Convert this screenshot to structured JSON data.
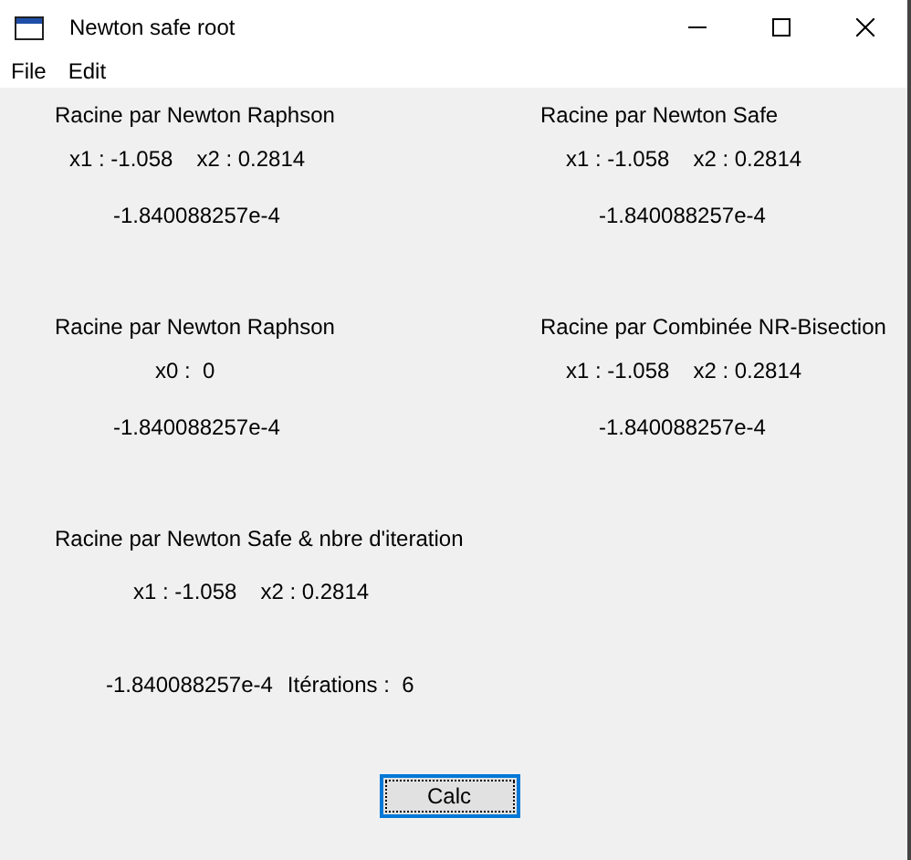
{
  "window": {
    "title": "Newton safe root"
  },
  "menu": [
    "File",
    "Edit"
  ],
  "sections": [
    {
      "title": "Racine par Newton Raphson",
      "params": [
        "x1 : -1.058",
        "x2 : 0.2814"
      ],
      "result": "-1.840088257e-4"
    },
    {
      "title": "Racine par Newton Safe",
      "params": [
        "x1 : -1.058",
        "x2 : 0.2814"
      ],
      "result": "-1.840088257e-4"
    },
    {
      "title": "Racine par Newton Raphson",
      "params": [
        "x0 :  0"
      ],
      "result": "-1.840088257e-4"
    },
    {
      "title": "Racine par Combinée NR-Bisection",
      "params": [
        "x1 : -1.058",
        "x2 : 0.2814"
      ],
      "result": "-1.840088257e-4"
    },
    {
      "title": "Racine par Newton Safe & nbre d'iteration",
      "params": [
        "x1 : -1.058",
        "x2 : 0.2814"
      ],
      "result": "-1.840088257e-4",
      "iterations": "Itérations :  6"
    }
  ],
  "button": "Calc"
}
